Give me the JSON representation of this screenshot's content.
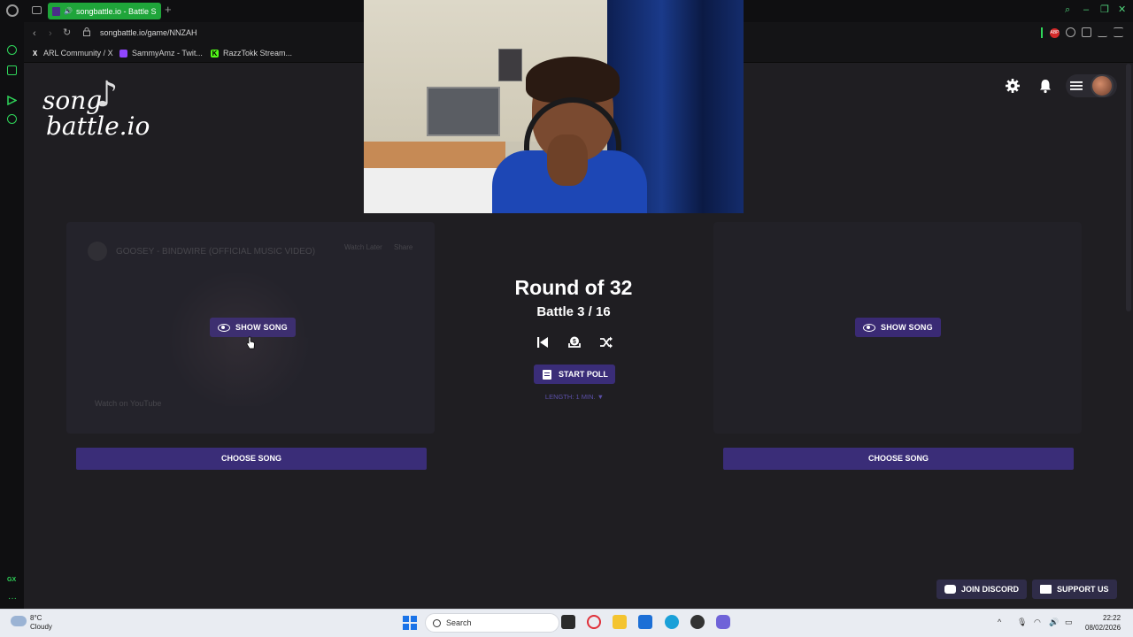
{
  "browser": {
    "tab_title": "songbattle.io - Battle S",
    "new_tab": "+",
    "url": "songbattle.io/game/NNZAH",
    "bookmarks": [
      {
        "label": "ARL Community / X",
        "icon": "x-icon"
      },
      {
        "label": "SammyAmz - Twit...",
        "icon": "twitch-icon"
      },
      {
        "label": "RazzTokk Stream...",
        "icon": "kick-icon"
      }
    ],
    "extension_badge": "ABP",
    "sidebar_label": "GX"
  },
  "site": {
    "logo_line1": "song",
    "logo_line2": "battle.io"
  },
  "left_panel": {
    "video_title": "GOOSEY - BINDWIRE (OFFICIAL MUSIC VIDEO)",
    "video_action1": "Watch Later",
    "video_action2": "Share",
    "video_watch_on": "Watch on YouTube",
    "show_song": "SHOW SONG",
    "choose_song": "CHOOSE SONG"
  },
  "right_panel": {
    "show_song": "SHOW SONG",
    "choose_song": "CHOOSE SONG"
  },
  "battle": {
    "round": "Round of 32",
    "battle": "Battle 3 / 16",
    "start_poll": "START POLL",
    "length": "LENGTH: 1 MIN. ▼"
  },
  "footer": {
    "join_discord": "JOIN DISCORD",
    "support_us": "SUPPORT US"
  },
  "taskbar": {
    "temperature": "8°C",
    "weather": "Cloudy",
    "search_placeholder": "Search",
    "time": "22:22",
    "date": "08/02/2026"
  },
  "colors": {
    "accent": "#3a2d78",
    "page_bg": "#1f1e22",
    "gx_green": "#2fd65a"
  }
}
